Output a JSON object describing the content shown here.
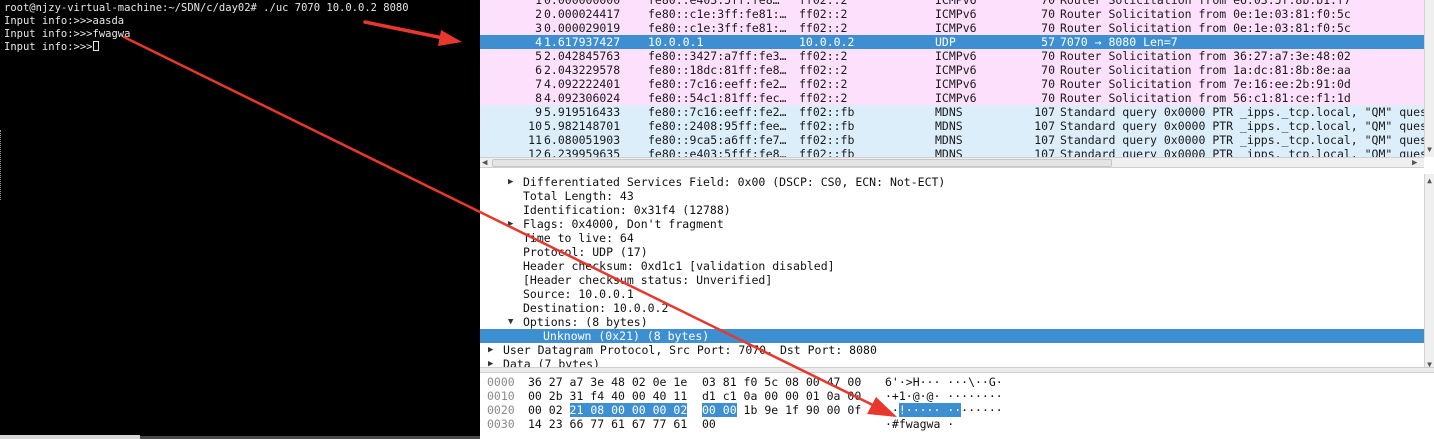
{
  "terminal": {
    "lines": [
      "root@njzy-virtual-machine:~/SDN/c/day02# ./uc 7070 10.0.0.2 8080",
      "Input info:>>>aasda",
      "Input info:>>>fwagwa",
      "Input info:>>>"
    ]
  },
  "packet_list": {
    "rows": [
      {
        "no": "1",
        "time": "0.000000000",
        "src": "fe80::e403:5ff:fe8…",
        "dst": "ff02::2",
        "proto": "ICMPv6",
        "len": "70",
        "info": "Router Solicitation from e6:03:5f:8b:b1:f7",
        "kind": "icmp"
      },
      {
        "no": "2",
        "time": "0.000024417",
        "src": "fe80::c1e:3ff:fe81:…",
        "dst": "ff02::2",
        "proto": "ICMPv6",
        "len": "70",
        "info": "Router Solicitation from 0e:1e:03:81:f0:5c",
        "kind": "icmp"
      },
      {
        "no": "3",
        "time": "0.000029019",
        "src": "fe80::c1e:3ff:fe81:…",
        "dst": "ff02::2",
        "proto": "ICMPv6",
        "len": "70",
        "info": "Router Solicitation from 0e:1e:03:81:f0:5c",
        "kind": "icmp"
      },
      {
        "no": "4",
        "time": "1.617937427",
        "src": "10.0.0.1",
        "dst": "10.0.0.2",
        "proto": "UDP",
        "len": "57",
        "info": "7070 → 8080 Len=7",
        "kind": "udp"
      },
      {
        "no": "5",
        "time": "2.042845763",
        "src": "fe80::3427:a7ff:fe3…",
        "dst": "ff02::2",
        "proto": "ICMPv6",
        "len": "70",
        "info": "Router Solicitation from 36:27:a7:3e:48:02",
        "kind": "icmp"
      },
      {
        "no": "6",
        "time": "2.043229578",
        "src": "fe80::18dc:81ff:fe8…",
        "dst": "ff02::2",
        "proto": "ICMPv6",
        "len": "70",
        "info": "Router Solicitation from 1a:dc:81:8b:8e:aa",
        "kind": "icmp"
      },
      {
        "no": "7",
        "time": "4.092222401",
        "src": "fe80::7c16:eeff:fe2…",
        "dst": "ff02::2",
        "proto": "ICMPv6",
        "len": "70",
        "info": "Router Solicitation from 7e:16:ee:2b:91:0d",
        "kind": "icmp"
      },
      {
        "no": "8",
        "time": "4.092306024",
        "src": "fe80::54c1:81ff:fec…",
        "dst": "ff02::2",
        "proto": "ICMPv6",
        "len": "70",
        "info": "Router Solicitation from 56:c1:81:ce:f1:1d",
        "kind": "icmp"
      },
      {
        "no": "9",
        "time": "5.919516433",
        "src": "fe80::7c16:eeff:fe2…",
        "dst": "ff02::fb",
        "proto": "MDNS",
        "len": "107",
        "info": "Standard query 0x0000 PTR _ipps._tcp.local, \"QM\" ques",
        "kind": "mdns"
      },
      {
        "no": "10",
        "time": "5.982148701",
        "src": "fe80::2408:95ff:fee…",
        "dst": "ff02::fb",
        "proto": "MDNS",
        "len": "107",
        "info": "Standard query 0x0000 PTR _ipps._tcp.local, \"QM\" ques",
        "kind": "mdns"
      },
      {
        "no": "11",
        "time": "6.080051903",
        "src": "fe80::9ca5:a6ff:fe7…",
        "dst": "ff02::fb",
        "proto": "MDNS",
        "len": "107",
        "info": "Standard query 0x0000 PTR _ipps._tcp.local, \"QM\" ques",
        "kind": "mdns"
      },
      {
        "no": "12",
        "time": "6.239959635",
        "src": "fe80::e403:5fff:fe8…",
        "dst": "ff02::fb",
        "proto": "MDNS",
        "len": "107",
        "info": "Standard query 0x0000 PTR _ipps._tcp.local, \"QM\" ques",
        "kind": "mdns"
      }
    ]
  },
  "details": {
    "rows": [
      {
        "text": "Differentiated Services Field: 0x00 (DSCP: CS0, ECN: Not-ECT)",
        "twisty": "▶",
        "level": 1,
        "selected": false
      },
      {
        "text": "Total Length: 43",
        "twisty": "",
        "level": 1,
        "selected": false
      },
      {
        "text": "Identification: 0x31f4 (12788)",
        "twisty": "",
        "level": 1,
        "selected": false
      },
      {
        "text": "Flags: 0x4000, Don't fragment",
        "twisty": "▶",
        "level": 1,
        "selected": false
      },
      {
        "text": "Time to live: 64",
        "twisty": "",
        "level": 1,
        "selected": false
      },
      {
        "text": "Protocol: UDP (17)",
        "twisty": "",
        "level": 1,
        "selected": false
      },
      {
        "text": "Header checksum: 0xd1c1 [validation disabled]",
        "twisty": "",
        "level": 1,
        "selected": false
      },
      {
        "text": "[Header checksum status: Unverified]",
        "twisty": "",
        "level": 1,
        "selected": false
      },
      {
        "text": "Source: 10.0.0.1",
        "twisty": "",
        "level": 1,
        "selected": false
      },
      {
        "text": "Destination: 10.0.0.2",
        "twisty": "",
        "level": 1,
        "selected": false
      },
      {
        "text": "Options: (8 bytes)",
        "twisty": "▼",
        "level": 1,
        "selected": false
      },
      {
        "text": "Unknown (0x21) (8 bytes)",
        "twisty": "",
        "level": 2,
        "selected": true
      },
      {
        "text": "User Datagram Protocol, Src Port: 7070, Dst Port: 8080",
        "twisty": "▶",
        "level": 0,
        "selected": false
      },
      {
        "text": "Data (7 bytes)",
        "twisty": "▶",
        "level": 0,
        "selected": false
      }
    ]
  },
  "hex": {
    "rows": [
      {
        "offset": "0000",
        "pre": "36 27 a7 3e 48 02 0e 1e",
        "sel": "",
        "post": "",
        "hex2": "03 81 f0 5c 08 00 47 00",
        "sel2": "",
        "post2": "",
        "ascii_pre": "6'·>H··· ···\\··G·",
        "ascii_sel": "",
        "ascii_post": ""
      },
      {
        "offset": "0010",
        "pre": "00 2b 31 f4 40 00 40 11",
        "sel": "",
        "post": "",
        "hex2": "d1 c1 0a 00 00 01 0a 00",
        "sel2": "",
        "post2": "",
        "ascii_pre": "·+1·@·@· ········",
        "ascii_sel": "",
        "ascii_post": ""
      },
      {
        "offset": "0020",
        "pre": "00 02 ",
        "sel": "21 08 00 00 00 02",
        "post": "",
        "hex2": "",
        "sel2": "00 00",
        "post2": " 1b 9e 1f 90 00 0f",
        "ascii_pre": "··",
        "ascii_sel": "!····· ··",
        "ascii_post": "······"
      },
      {
        "offset": "0030",
        "pre": "14 23 66 77 61 67 77 61",
        "sel": "",
        "post": "",
        "hex2": "00",
        "sel2": "",
        "post2": "",
        "ascii_pre": "·#fwagwa ·",
        "ascii_sel": "",
        "ascii_post": ""
      }
    ]
  },
  "colors": {
    "annotation_arrow": "#e8372c",
    "selection": "#3d8fd1",
    "icmp_row": "#fde0fb",
    "mdns_row": "#dbeefa"
  }
}
